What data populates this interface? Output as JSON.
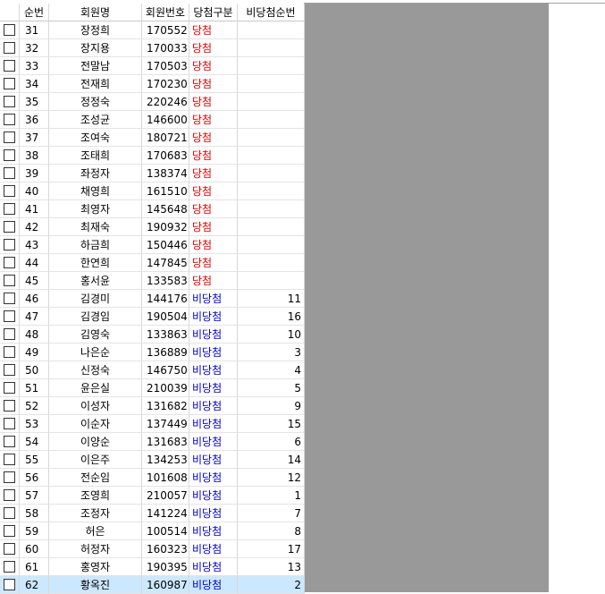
{
  "headers": {
    "seq": "순번",
    "name": "회원명",
    "member_no": "회원번호",
    "type": "당첨구분",
    "rank": "비당첨순번"
  },
  "colors": {
    "win": "#e00000",
    "lose": "#0000cc",
    "selected_row": "#cce8ff",
    "empty_area": "#999999"
  },
  "rows": [
    {
      "seq": "31",
      "name": "장정희",
      "member_no": "170552",
      "type": "당첨",
      "status": "win",
      "rank": "",
      "checked": false
    },
    {
      "seq": "32",
      "name": "장지용",
      "member_no": "170033",
      "type": "당첨",
      "status": "win",
      "rank": "",
      "checked": false
    },
    {
      "seq": "33",
      "name": "전말남",
      "member_no": "170503",
      "type": "당첨",
      "status": "win",
      "rank": "",
      "checked": false
    },
    {
      "seq": "34",
      "name": "전재희",
      "member_no": "170230",
      "type": "당첨",
      "status": "win",
      "rank": "",
      "checked": false
    },
    {
      "seq": "35",
      "name": "정정숙",
      "member_no": "220246",
      "type": "당첨",
      "status": "win",
      "rank": "",
      "checked": false
    },
    {
      "seq": "36",
      "name": "조성균",
      "member_no": "146600",
      "type": "당첨",
      "status": "win",
      "rank": "",
      "checked": false
    },
    {
      "seq": "37",
      "name": "조여숙",
      "member_no": "180721",
      "type": "당첨",
      "status": "win",
      "rank": "",
      "checked": false
    },
    {
      "seq": "38",
      "name": "조태희",
      "member_no": "170683",
      "type": "당첨",
      "status": "win",
      "rank": "",
      "checked": false
    },
    {
      "seq": "39",
      "name": "좌정자",
      "member_no": "138374",
      "type": "당첨",
      "status": "win",
      "rank": "",
      "checked": false
    },
    {
      "seq": "40",
      "name": "채영희",
      "member_no": "161510",
      "type": "당첨",
      "status": "win",
      "rank": "",
      "checked": false
    },
    {
      "seq": "41",
      "name": "최영자",
      "member_no": "145648",
      "type": "당첨",
      "status": "win",
      "rank": "",
      "checked": false
    },
    {
      "seq": "42",
      "name": "최재숙",
      "member_no": "190932",
      "type": "당첨",
      "status": "win",
      "rank": "",
      "checked": false
    },
    {
      "seq": "43",
      "name": "하금희",
      "member_no": "150446",
      "type": "당첨",
      "status": "win",
      "rank": "",
      "checked": false
    },
    {
      "seq": "44",
      "name": "한연희",
      "member_no": "147845",
      "type": "당첨",
      "status": "win",
      "rank": "",
      "checked": false
    },
    {
      "seq": "45",
      "name": "홍서윤",
      "member_no": "133583",
      "type": "당첨",
      "status": "win",
      "rank": "",
      "checked": false
    },
    {
      "seq": "46",
      "name": "김경미",
      "member_no": "144176",
      "type": "비당첨",
      "status": "lose",
      "rank": "11",
      "checked": false
    },
    {
      "seq": "47",
      "name": "김경임",
      "member_no": "190504",
      "type": "비당첨",
      "status": "lose",
      "rank": "16",
      "checked": false
    },
    {
      "seq": "48",
      "name": "김영숙",
      "member_no": "133863",
      "type": "비당첨",
      "status": "lose",
      "rank": "10",
      "checked": false
    },
    {
      "seq": "49",
      "name": "나은순",
      "member_no": "136889",
      "type": "비당첨",
      "status": "lose",
      "rank": "3",
      "checked": false
    },
    {
      "seq": "50",
      "name": "신정숙",
      "member_no": "146750",
      "type": "비당첨",
      "status": "lose",
      "rank": "4",
      "checked": false
    },
    {
      "seq": "51",
      "name": "윤은실",
      "member_no": "210039",
      "type": "비당첨",
      "status": "lose",
      "rank": "5",
      "checked": false
    },
    {
      "seq": "52",
      "name": "이성자",
      "member_no": "131682",
      "type": "비당첨",
      "status": "lose",
      "rank": "9",
      "checked": false
    },
    {
      "seq": "53",
      "name": "이순자",
      "member_no": "137449",
      "type": "비당첨",
      "status": "lose",
      "rank": "15",
      "checked": false
    },
    {
      "seq": "54",
      "name": "이양순",
      "member_no": "131683",
      "type": "비당첨",
      "status": "lose",
      "rank": "6",
      "checked": false
    },
    {
      "seq": "55",
      "name": "이은주",
      "member_no": "134253",
      "type": "비당첨",
      "status": "lose",
      "rank": "14",
      "checked": false
    },
    {
      "seq": "56",
      "name": "전순임",
      "member_no": "101608",
      "type": "비당첨",
      "status": "lose",
      "rank": "12",
      "checked": false
    },
    {
      "seq": "57",
      "name": "조영희",
      "member_no": "210057",
      "type": "비당첨",
      "status": "lose",
      "rank": "1",
      "checked": false
    },
    {
      "seq": "58",
      "name": "조정자",
      "member_no": "141224",
      "type": "비당첨",
      "status": "lose",
      "rank": "7",
      "checked": false
    },
    {
      "seq": "59",
      "name": "허은",
      "member_no": "100514",
      "type": "비당첨",
      "status": "lose",
      "rank": "8",
      "checked": false
    },
    {
      "seq": "60",
      "name": "허정자",
      "member_no": "160323",
      "type": "비당첨",
      "status": "lose",
      "rank": "17",
      "checked": false
    },
    {
      "seq": "61",
      "name": "홍영자",
      "member_no": "190395",
      "type": "비당첨",
      "status": "lose",
      "rank": "13",
      "checked": false
    },
    {
      "seq": "62",
      "name": "황옥진",
      "member_no": "160987",
      "type": "비당첨",
      "status": "lose",
      "rank": "2",
      "checked": false,
      "selected": true
    }
  ]
}
